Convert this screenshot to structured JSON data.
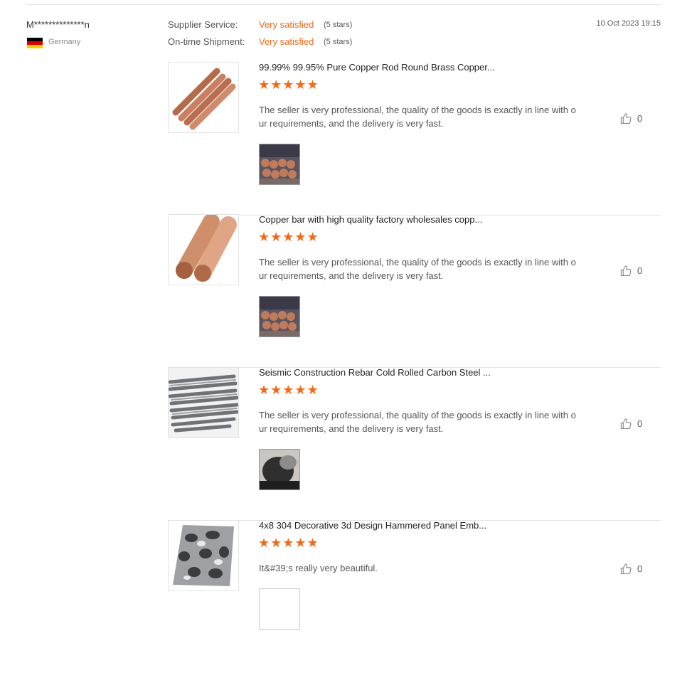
{
  "buyer": {
    "name": "M**************n",
    "country": "Germany",
    "flag_colors": [
      "#000000",
      "#dd0000",
      "#ffce00"
    ]
  },
  "ratings": [
    {
      "label": "Supplier Service:",
      "value": "Very satisfied",
      "stars": "(5 stars)"
    },
    {
      "label": "On-time Shipment:",
      "value": "Very satisfied",
      "stars": "(5 stars)"
    }
  ],
  "date": "10 Oct 2023 19:15",
  "items": [
    {
      "title": "99.99% 99.95% Pure Copper Rod Round Brass Copper...",
      "stars": "★★★★★",
      "rating": 5,
      "text": "The seller is very professional, the quality of the goods is exactly in line with our requirements, and the delivery is very fast.",
      "likes": "0"
    },
    {
      "title": "Copper bar with high quality factory wholesales copp...",
      "stars": "★★★★★",
      "rating": 5,
      "text": "The seller is very professional, the quality of the goods is exactly in line with our requirements, and the delivery is very fast.",
      "likes": "0"
    },
    {
      "title": "Seismic Construction Rebar Cold Rolled Carbon Steel ...",
      "stars": "★★★★★",
      "rating": 5,
      "text": "The seller is very professional, the quality of the goods is exactly in line with our requirements, and the delivery is very fast.",
      "likes": "0"
    },
    {
      "title": "4x8 304 Decorative 3d Design Hammered Panel Emb...",
      "stars": "★★★★★",
      "rating": 5,
      "text": "It&#39;s really very beautiful.",
      "likes": "0"
    }
  ],
  "colors": {
    "accent": "#f06a19"
  }
}
